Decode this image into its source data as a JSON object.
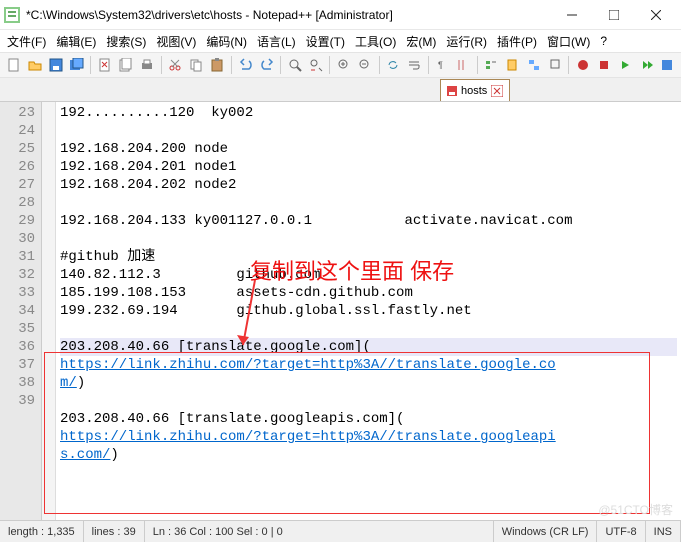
{
  "window": {
    "title": "*C:\\Windows\\System32\\drivers\\etc\\hosts - Notepad++ [Administrator]"
  },
  "menu": {
    "file": "文件(F)",
    "edit": "编辑(E)",
    "search": "搜索(S)",
    "view": "视图(V)",
    "encoding": "编码(N)",
    "language": "语言(L)",
    "settings": "设置(T)",
    "tools": "工具(O)",
    "macro": "宏(M)",
    "run": "运行(R)",
    "plugins": "插件(P)",
    "window": "窗口(W)",
    "help": "?"
  },
  "tab": {
    "name": "hosts"
  },
  "annotation": "复制到这个里面 保存",
  "lines": [
    {
      "n": "23",
      "t": "192..........120  ky002"
    },
    {
      "n": "24",
      "t": ""
    },
    {
      "n": "25",
      "t": "192.168.204.200 node"
    },
    {
      "n": "26",
      "t": "192.168.204.201 node1"
    },
    {
      "n": "27",
      "t": "192.168.204.202 node2"
    },
    {
      "n": "28",
      "t": ""
    },
    {
      "n": "29",
      "t": "192.168.204.133 ky001127.0.0.1           activate.navicat.com"
    },
    {
      "n": "30",
      "t": ""
    },
    {
      "n": "31",
      "t": "#github 加速"
    },
    {
      "n": "32",
      "t": "140.82.112.3         github.com"
    },
    {
      "n": "33",
      "t": "185.199.108.153      assets-cdn.github.com"
    },
    {
      "n": "34",
      "t": "199.232.69.194       github.global.ssl.fastly.net"
    },
    {
      "n": "35",
      "t": ""
    },
    {
      "n": "36",
      "t": "203.208.40.66 [translate.google.com]("
    },
    {
      "n": "",
      "t": "https://link.zhihu.com/?target=http%3A//translate.google.co",
      "link": true
    },
    {
      "n": "",
      "t": "m/)",
      "linkpart": "m/"
    },
    {
      "n": "37",
      "t": ""
    },
    {
      "n": "38",
      "t": "203.208.40.66 [translate.googleapis.com]("
    },
    {
      "n": "",
      "t": "https://link.zhihu.com/?target=http%3A//translate.googleapi",
      "link": true
    },
    {
      "n": "",
      "t": "s.com/)",
      "linkpart": "s.com/"
    },
    {
      "n": "39",
      "t": ""
    }
  ],
  "status": {
    "length": "length : 1,335",
    "lines": "lines : 39",
    "pos": "Ln : 36   Col : 100   Sel : 0 | 0",
    "eol": "Windows (CR LF)",
    "enc": "UTF-8",
    "ins": "INS"
  },
  "watermark": "@51CTO博客"
}
